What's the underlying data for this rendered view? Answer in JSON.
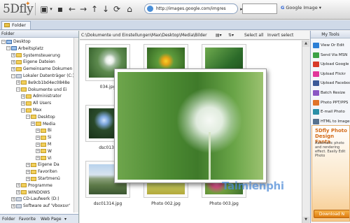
{
  "app": {
    "logo": "5Dfly"
  },
  "address": {
    "url": "http://images.google.com/imgres"
  },
  "search": {
    "engine": "Google Image"
  },
  "tabs": {
    "folder": "Folder"
  },
  "left_panel": {
    "header": "Folder",
    "tree": [
      {
        "label": "Desktop",
        "level": 0,
        "icon": "pc",
        "expanded": true
      },
      {
        "label": "Arbeitsplatz",
        "level": 1,
        "icon": "pc",
        "expanded": true
      },
      {
        "label": "Systemsteuerung",
        "level": 2,
        "icon": "fo"
      },
      {
        "label": "Eigene Dateien",
        "level": 2,
        "icon": "fo"
      },
      {
        "label": "Gemeinsame Dokumen",
        "level": 2,
        "icon": "fo"
      },
      {
        "label": "Lokaler Datenträger (C:)",
        "level": 2,
        "icon": "dr",
        "expanded": true
      },
      {
        "label": "8e9cb1bd4ec0848e",
        "level": 3,
        "icon": "fo"
      },
      {
        "label": "Dokumente und Ei",
        "level": 3,
        "icon": "fo",
        "expanded": true
      },
      {
        "label": "Administrator",
        "level": 4,
        "icon": "fo"
      },
      {
        "label": "All Users",
        "level": 4,
        "icon": "fo"
      },
      {
        "label": "Max",
        "level": 4,
        "icon": "fo",
        "expanded": true
      },
      {
        "label": "Desktop",
        "level": 5,
        "icon": "fo",
        "expanded": true
      },
      {
        "label": "Media",
        "level": 6,
        "icon": "fo"
      },
      {
        "label": "Bi",
        "level": 7,
        "icon": "fo"
      },
      {
        "label": "Si",
        "level": 7,
        "icon": "fo"
      },
      {
        "label": "M",
        "level": 7,
        "icon": "fo"
      },
      {
        "label": "W",
        "level": 7,
        "icon": "fo"
      },
      {
        "label": "Vi",
        "level": 7,
        "icon": "fo"
      },
      {
        "label": "Eigene Da",
        "level": 5,
        "icon": "fo"
      },
      {
        "label": "Favoriten",
        "level": 5,
        "icon": "fo"
      },
      {
        "label": "Startmenü",
        "level": 5,
        "icon": "fo"
      },
      {
        "label": "Programme",
        "level": 3,
        "icon": "fo"
      },
      {
        "label": "WINDOWS",
        "level": 3,
        "icon": "fo"
      },
      {
        "label": "CD-Laufwerk (D:)",
        "level": 2,
        "icon": "dr"
      },
      {
        "label": "Software auf 'Vboxsvr'",
        "level": 2,
        "icon": "dr"
      }
    ],
    "bottom_tabs": [
      "Folder",
      "Favorite",
      "Web Page"
    ]
  },
  "path_bar": {
    "path": "C:\\Dokumente und Einstellungen\\Max\\Desktop\\Media\\Bilder",
    "select_all": "Select all",
    "invert_select": "Invert select"
  },
  "thumbnails": [
    {
      "caption": "034.jpg",
      "image": "img-dand"
    },
    {
      "caption": "",
      "image": "img-flower"
    },
    {
      "caption": "",
      "image": "img-green"
    },
    {
      "caption": "dsc0130",
      "image": "img-blue"
    },
    {
      "caption": "",
      "image": "img-green"
    },
    {
      "caption": "",
      "image": "img-green"
    },
    {
      "caption": "dsc01314.jpg",
      "image": "img-land"
    },
    {
      "caption": "Photo 002.jpg",
      "image": "img-field"
    },
    {
      "caption": "Photo 003.jpg",
      "image": "img-pinks"
    }
  ],
  "right_panel": {
    "header": "My Tools",
    "tools": [
      {
        "label": "View Or Edit",
        "color": "#2c7fd6"
      },
      {
        "label": "Send Via MSN",
        "color": "#3ba146"
      },
      {
        "label": "Upload Google",
        "color": "#d83a2b"
      },
      {
        "label": "Upload Flickr",
        "color": "#e2369b"
      },
      {
        "label": "Upload Facebook",
        "color": "#3b5998"
      },
      {
        "label": "Batch Resize",
        "color": "#8a56c4"
      },
      {
        "label": "Photo PPT/PPS",
        "color": "#e0742a"
      },
      {
        "label": "E-mail Photo",
        "color": "#2a8fa8"
      },
      {
        "label": "HTML to Image",
        "color": "#56718f"
      }
    ],
    "ad": {
      "title": "5Dfly Photo Design Fanta",
      "sub": "Automatic photo and rendering effect. Easily Edit Photo",
      "download": "Download N"
    }
  },
  "watermark": "Taimienphi"
}
